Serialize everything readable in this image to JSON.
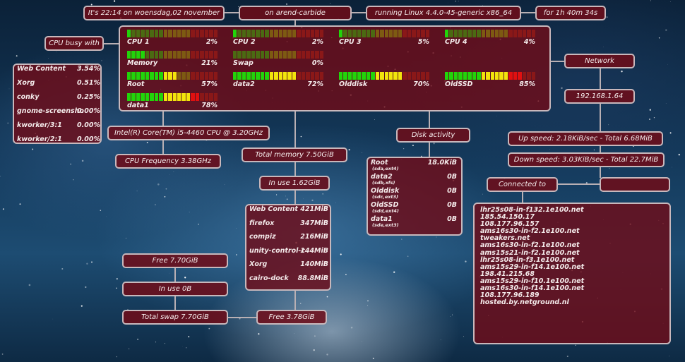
{
  "header": {
    "time": "It's 22:14 on woensdag,02 november",
    "host": "on arend-carbide",
    "kernel": "running Linux 4.4.0-45-generic x86_64",
    "uptime": "for 1h 40m 34s"
  },
  "cpu_busy": {
    "title": "CPU busy with",
    "processes": [
      {
        "name": "Web Content",
        "value": "3.54%"
      },
      {
        "name": "Xorg",
        "value": "0.51%"
      },
      {
        "name": "conky",
        "value": "0.25%"
      },
      {
        "name": "gnome-screensho",
        "value": "0.00%"
      },
      {
        "name": "kworker/3:1",
        "value": "0.00%"
      },
      {
        "name": "kworker/2:1",
        "value": "0.00%"
      }
    ]
  },
  "meters": [
    {
      "label": "CPU 1",
      "value": "2%",
      "level": 0.02
    },
    {
      "label": "CPU 2",
      "value": "2%",
      "level": 0.02
    },
    {
      "label": "CPU 3",
      "value": "5%",
      "level": 0.05
    },
    {
      "label": "CPU 4",
      "value": "4%",
      "level": 0.04
    },
    {
      "label": "Memory",
      "value": "21%",
      "level": 0.21
    },
    {
      "label": "Swap",
      "value": "0%",
      "level": 0.0
    },
    {
      "label": "Root",
      "value": "57%",
      "level": 0.57
    },
    {
      "label": "data2",
      "value": "72%",
      "level": 0.72
    },
    {
      "label": "Olddisk",
      "value": "70%",
      "level": 0.7
    },
    {
      "label": "OldSSD",
      "value": "85%",
      "level": 0.85
    },
    {
      "label": "data1",
      "value": "78%",
      "level": 0.78
    }
  ],
  "cpu_info": {
    "model": "Intel(R) Core(TM) i5-4460  CPU @ 3.20GHz",
    "frequency": "CPU Frequency 3.38GHz"
  },
  "memory": {
    "total": "Total memory 7.50GiB",
    "in_use": "In use 1.62GiB",
    "free": "Free 3.78GiB",
    "processes": [
      {
        "name": "Web Content",
        "value": "421MiB"
      },
      {
        "name": "firefox",
        "value": "347MiB"
      },
      {
        "name": "compiz",
        "value": "216MiB"
      },
      {
        "name": "unity-control-c",
        "value": "144MiB"
      },
      {
        "name": "Xorg",
        "value": "140MiB"
      },
      {
        "name": "cairo-dock",
        "value": "88.8MiB"
      }
    ]
  },
  "swap": {
    "free": "Free 7.70GiB",
    "in_use": "In use 0B",
    "total": "Total swap 7.70GiB"
  },
  "disk": {
    "title": "Disk activity",
    "items": [
      {
        "name": "Root",
        "dev": "(sda,ext4)",
        "value": "18.0KiB"
      },
      {
        "name": "data2",
        "dev": "(sdb,xfs)",
        "value": "0B"
      },
      {
        "name": "Olddisk",
        "dev": "(sdc,ext3)",
        "value": "0B"
      },
      {
        "name": "OldSSD",
        "dev": "(sdd,ext4)",
        "value": "0B"
      },
      {
        "name": "data1",
        "dev": "(sde,ext3)",
        "value": "0B"
      }
    ]
  },
  "network": {
    "title": "Network",
    "ip": "192.168.1.64",
    "up": "Up speed: 2.18KiB/sec - Total 6.68MiB",
    "down": "Down speed: 3.03KiB/sec - Total 22.7MiB",
    "connected_label": "Connected to",
    "connected_extra": "",
    "connections": [
      "lhr25s08-in-f132.1e100.net",
      "185.54.150.17",
      "108.177.96.157",
      "ams16s30-in-f2.1e100.net",
      "tweakers.net",
      "ams16s30-in-f2.1e100.net",
      "ams15s21-in-f2.1e100.net",
      "lhr25s08-in-f3.1e100.net",
      "ams15s29-in-f14.1e100.net",
      "198.41.215.68",
      "ams15s29-in-f10.1e100.net",
      "ams16s30-in-f14.1e100.net",
      "108.177.96.189",
      "hosted.by.netground.nl"
    ]
  },
  "colors": {
    "panel": "#6e0c18",
    "border": "#c8b8bc",
    "bar_green": "#22d40a",
    "bar_yellow": "#f2e40c",
    "bar_red": "#e01010"
  }
}
